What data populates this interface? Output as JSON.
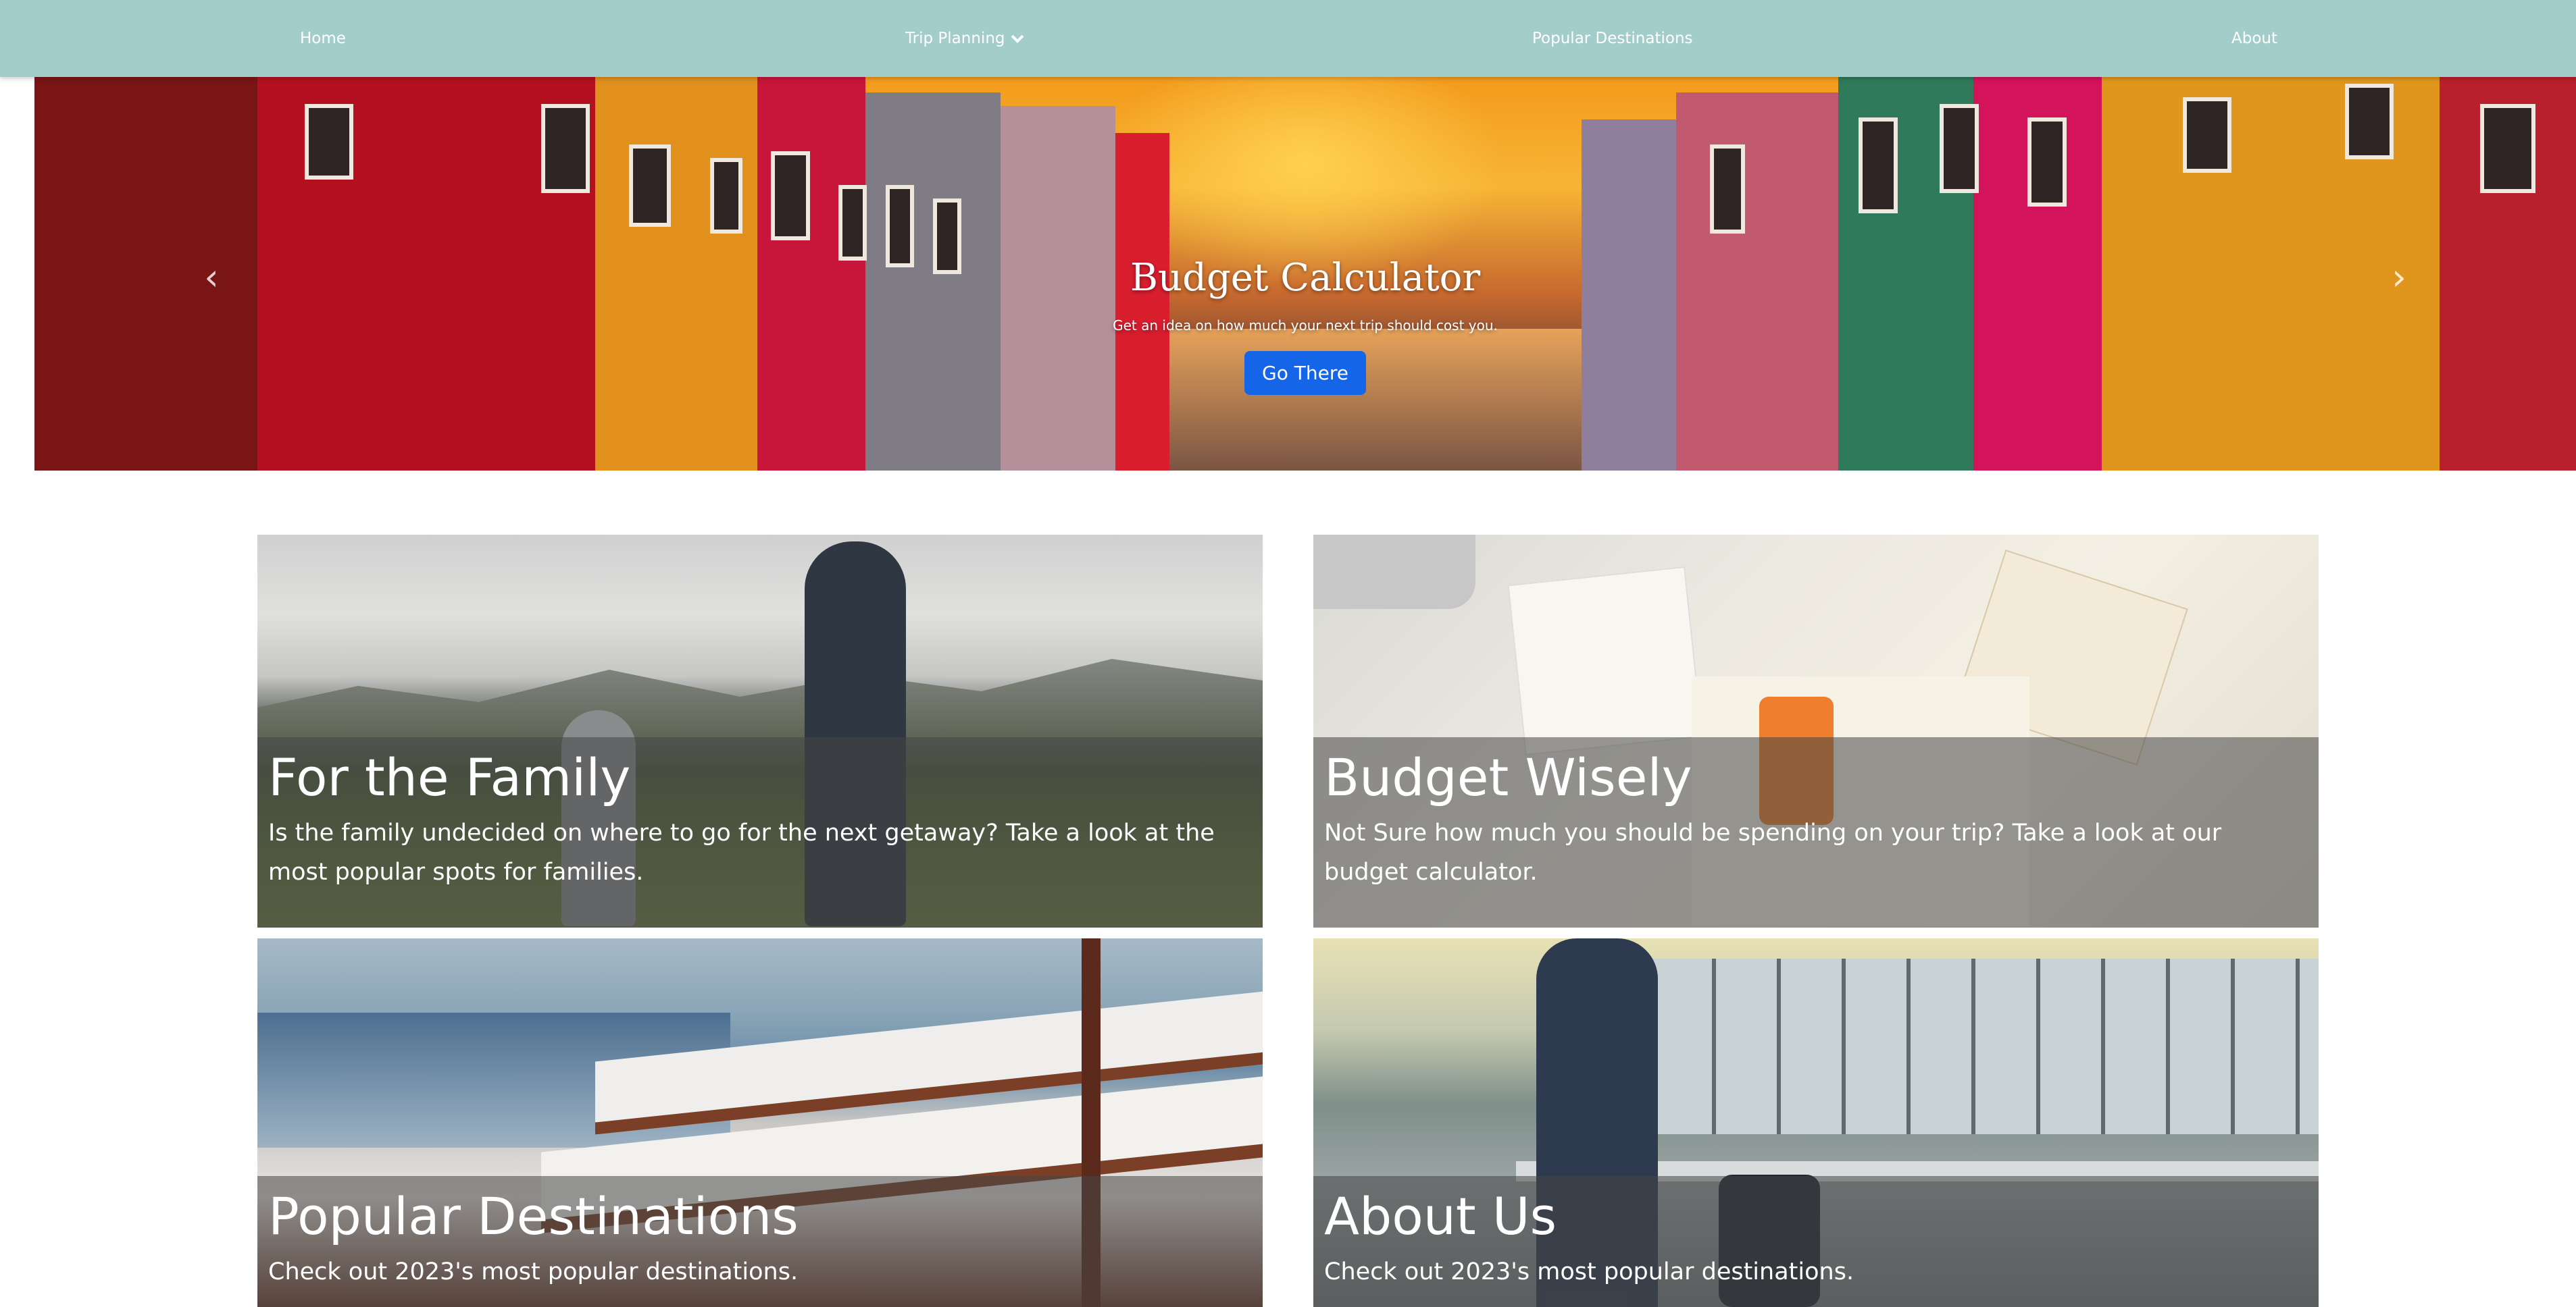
{
  "nav": {
    "items": [
      {
        "label": "Home"
      },
      {
        "label": "Trip Planning",
        "icon": "chevron-down-icon"
      },
      {
        "label": "Popular Destinations"
      },
      {
        "label": "About"
      }
    ]
  },
  "carousel": {
    "title": "Budget Calculator",
    "text": "Get an idea on how much your next trip should cost you.",
    "button": "Go There",
    "prev_icon": "chevron-left-icon",
    "next_icon": "chevron-right-icon",
    "image": "colorful-canal-houses-sunset"
  },
  "cards": [
    {
      "title": "For the Family",
      "text": "Is the family undecided on where to go for the next getaway? Take a look at the most popular spots for families.",
      "image": "family-mountains"
    },
    {
      "title": "Budget Wisely",
      "text": "Not Sure how much you should be spending on your trip? Take a look at our budget calculator.",
      "image": "calculator-notebook"
    },
    {
      "title": "Popular Destinations",
      "text": "Check out 2023's most popular destinations.",
      "image": "poolside-loungers"
    },
    {
      "title": "About Us",
      "text": "Check out 2023's most popular destinations.",
      "image": "airport-traveler"
    }
  ],
  "colors": {
    "navbar": "#a3cdcb",
    "button": "#1565e8",
    "overlay": "rgba(70,70,70,0.55)"
  }
}
